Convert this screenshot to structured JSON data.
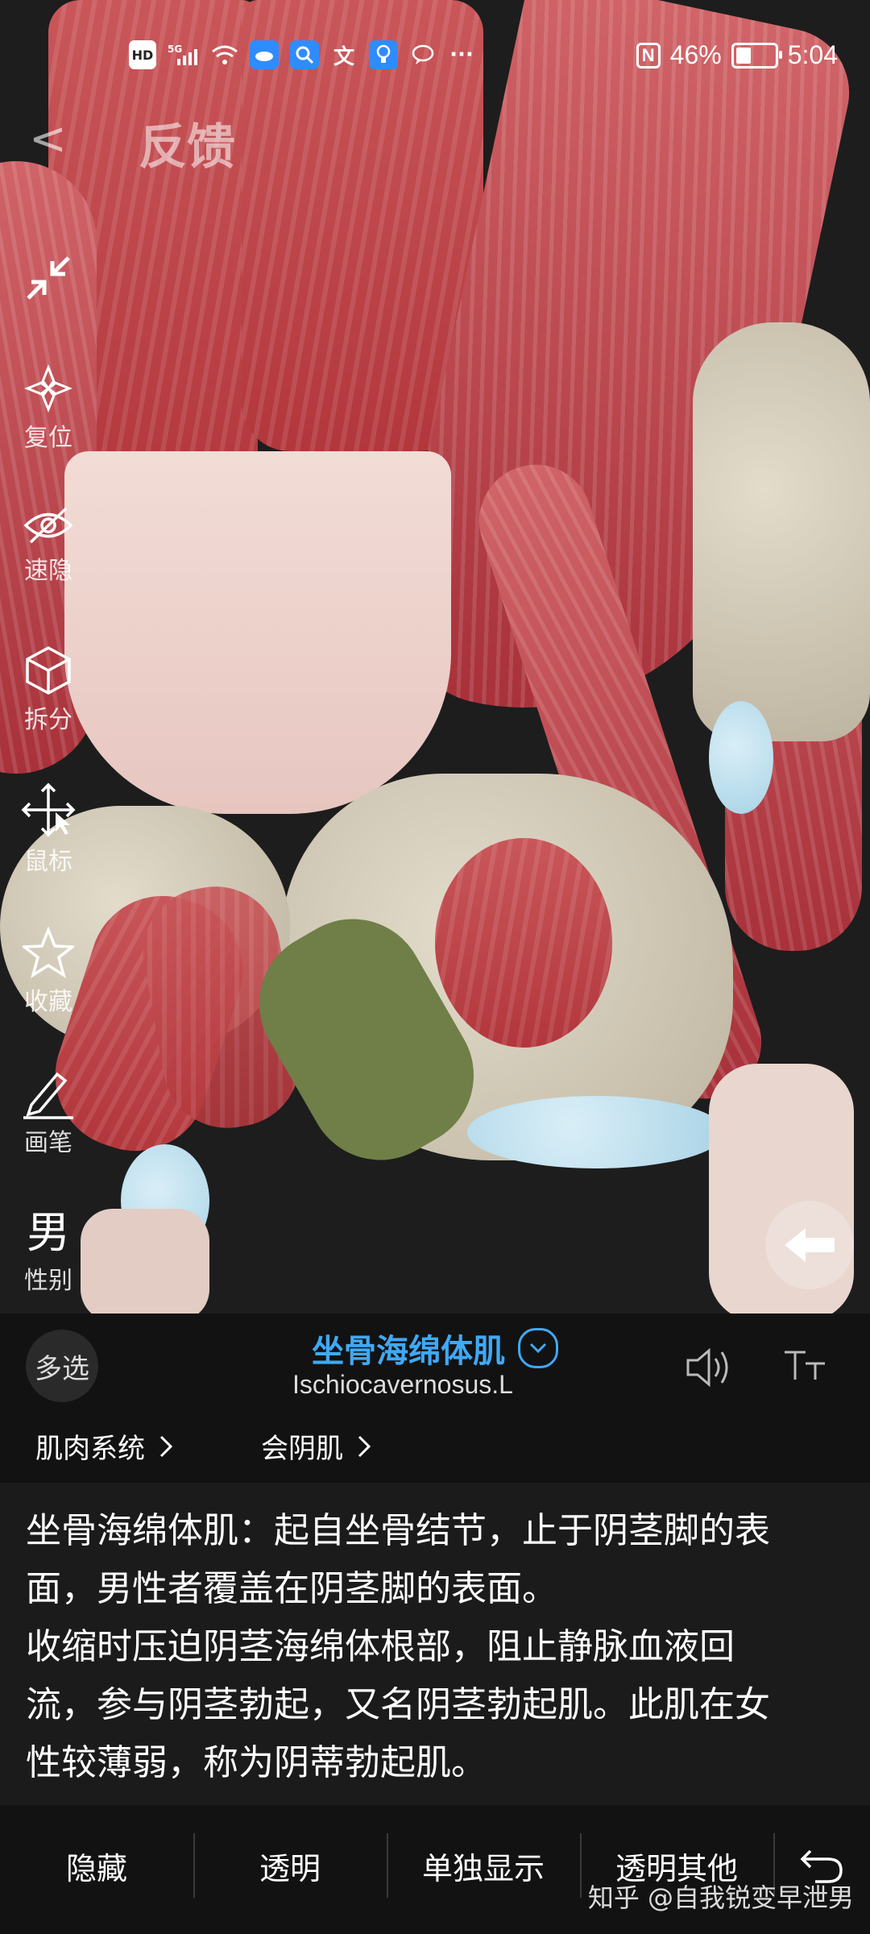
{
  "status_bar": {
    "left_icons": [
      "HD",
      "5G",
      "signal-icon",
      "wifi-icon",
      "cloud-app-icon",
      "search-app-icon",
      "translate-icon",
      "bulb-icon",
      "chat-icon",
      "more-icon"
    ],
    "nfc": "N",
    "battery": "46%",
    "battery_level": 0.46,
    "time": "5:04"
  },
  "header": {
    "back": "<",
    "title": "反馈"
  },
  "toolbar": {
    "items": [
      {
        "label": "复位",
        "icon": "reset-icon"
      },
      {
        "label": "速隐",
        "icon": "eye-hide-icon"
      },
      {
        "label": "拆分",
        "icon": "cube-split-icon"
      },
      {
        "label": "鼠标",
        "icon": "mouse-move-icon"
      },
      {
        "label": "收藏",
        "icon": "star-icon"
      },
      {
        "label": "画笔",
        "icon": "pen-icon"
      }
    ],
    "gender_glyph": "男",
    "gender_label": "性别",
    "collapse_icon": "collapse-arrows-icon"
  },
  "panel": {
    "multi_select": "多选",
    "muscle_cn": "坐骨海绵体肌",
    "muscle_en": "Ischiocavernosus.L",
    "breadcrumbs": [
      "肌肉系统",
      "会阴肌"
    ],
    "description_lines": [
      "坐骨海绵体肌：起自坐骨结节，止于阴茎脚的表",
      "面，男性者覆盖在阴茎脚的表面。",
      "收缩时压迫阴茎海绵体根部，阻止静脉血液回",
      "流，参与阴茎勃起，又名阴茎勃起肌。此肌在女",
      "性较薄弱，称为阴蒂勃起肌。"
    ],
    "actions": [
      "隐藏",
      "透明",
      "单独显示",
      "透明其他"
    ],
    "watermark": "知乎 @自我锐变早泄男"
  },
  "colors": {
    "accent": "#3fa9f5",
    "muscle": "#c24a4f",
    "bone": "#d8d0bd",
    "cartilage": "#b9dcec"
  }
}
